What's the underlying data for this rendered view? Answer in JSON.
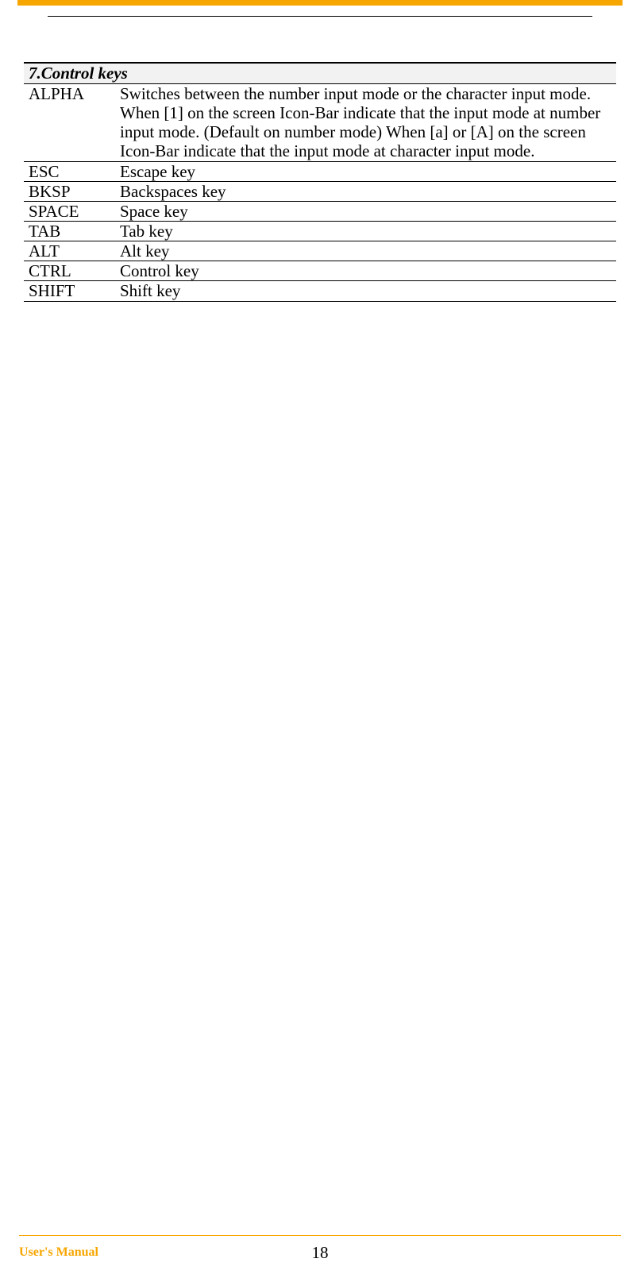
{
  "section_title": "7.Control  keys",
  "rows": [
    {
      "key": "ALPHA",
      "desc": "Switches between the number input mode or the character input mode. When [1] on the screen Icon-Bar indicate that the input mode at number input mode. (Default on number mode)\nWhen [a] or [A] on the screen Icon-Bar indicate that the input mode at character input mode.",
      "tall": false
    },
    {
      "key": "ESC",
      "desc": "Escape key",
      "tall": true
    },
    {
      "key": "BKSP",
      "desc": "Backspaces key",
      "tall": true
    },
    {
      "key": "SPACE",
      "desc": "Space key",
      "tall": false
    },
    {
      "key": "TAB",
      "desc": "Tab key",
      "tall": false
    },
    {
      "key": "ALT",
      "desc": "Alt key",
      "tall": false
    },
    {
      "key": "CTRL",
      "desc": "Control key",
      "tall": false
    },
    {
      "key": "SHIFT",
      "desc": "Shift key",
      "tall": false
    }
  ],
  "footer": {
    "left": "User's Manual",
    "page": "18"
  }
}
